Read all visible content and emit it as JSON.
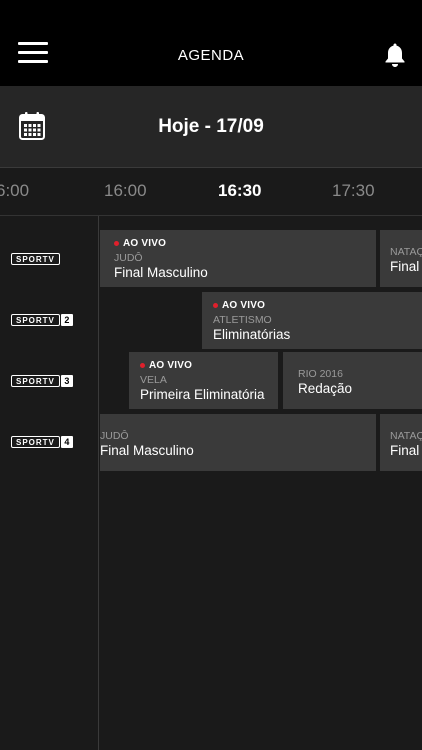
{
  "header": {
    "title": "AGENDA"
  },
  "datebar": {
    "date_label": "Hoje - 17/09"
  },
  "timeline": {
    "ticks": [
      "6:00",
      "16:00",
      "16:30",
      "17:30"
    ],
    "active_tick": "16:30"
  },
  "channels": [
    {
      "name": "SPORTV",
      "number": ""
    },
    {
      "name": "SPORTV",
      "number": "2"
    },
    {
      "name": "SPORTV",
      "number": "3"
    },
    {
      "name": "SPORTV",
      "number": "4"
    }
  ],
  "live_label": "AO VIVO",
  "programs": {
    "row1": [
      {
        "live": true,
        "category": "JUDÔ",
        "title": "Final Masculino"
      },
      {
        "live": false,
        "category": "NATAÇ",
        "title": "Final"
      }
    ],
    "row2": [
      {
        "live": true,
        "category": "ATLETISMO",
        "title": "Eliminatórias"
      }
    ],
    "row3": [
      {
        "live": true,
        "category": "VELA",
        "title": "Primeira Eliminatória"
      },
      {
        "live": false,
        "category": "RIO 2016",
        "title": "Redação"
      }
    ],
    "row4": [
      {
        "live": false,
        "category": "JUDÔ",
        "title": "Final Masculino"
      },
      {
        "live": false,
        "category": "NATAÇ",
        "title": "Final"
      }
    ]
  },
  "colors": {
    "live_dot": "#e0202c",
    "card_bg": "#3a3a3a",
    "header_bg": "#000000"
  }
}
